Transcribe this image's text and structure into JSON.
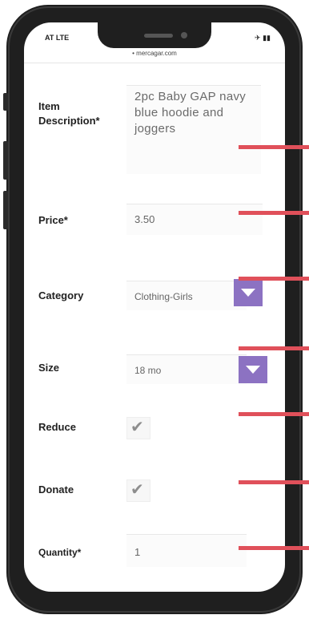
{
  "status_bar": {
    "carrier": "AT LTE",
    "battery": ""
  },
  "url_bar": {
    "text": "• mercagar.com"
  },
  "form": {
    "item_description": {
      "label": "Item Description*",
      "value": "2pc Baby GAP navy blue hoodie and joggers"
    },
    "price": {
      "label": "Price*",
      "value": "3.50"
    },
    "category": {
      "label": "Category",
      "value": "Clothing-Girls"
    },
    "size": {
      "label": "Size",
      "value": "18 mo"
    },
    "reduce": {
      "label": "Reduce",
      "checked": true
    },
    "donate": {
      "label": "Donate",
      "checked": true
    },
    "quantity": {
      "label": "Quantity*",
      "value": "1"
    }
  },
  "colors": {
    "dropdown_accent": "#8c72c2",
    "callout_lines": "#e0505a",
    "phone_frame": "#1f1f1f"
  },
  "icons": {
    "dropdown": "chevron-down-icon",
    "checkbox": "check-icon"
  }
}
